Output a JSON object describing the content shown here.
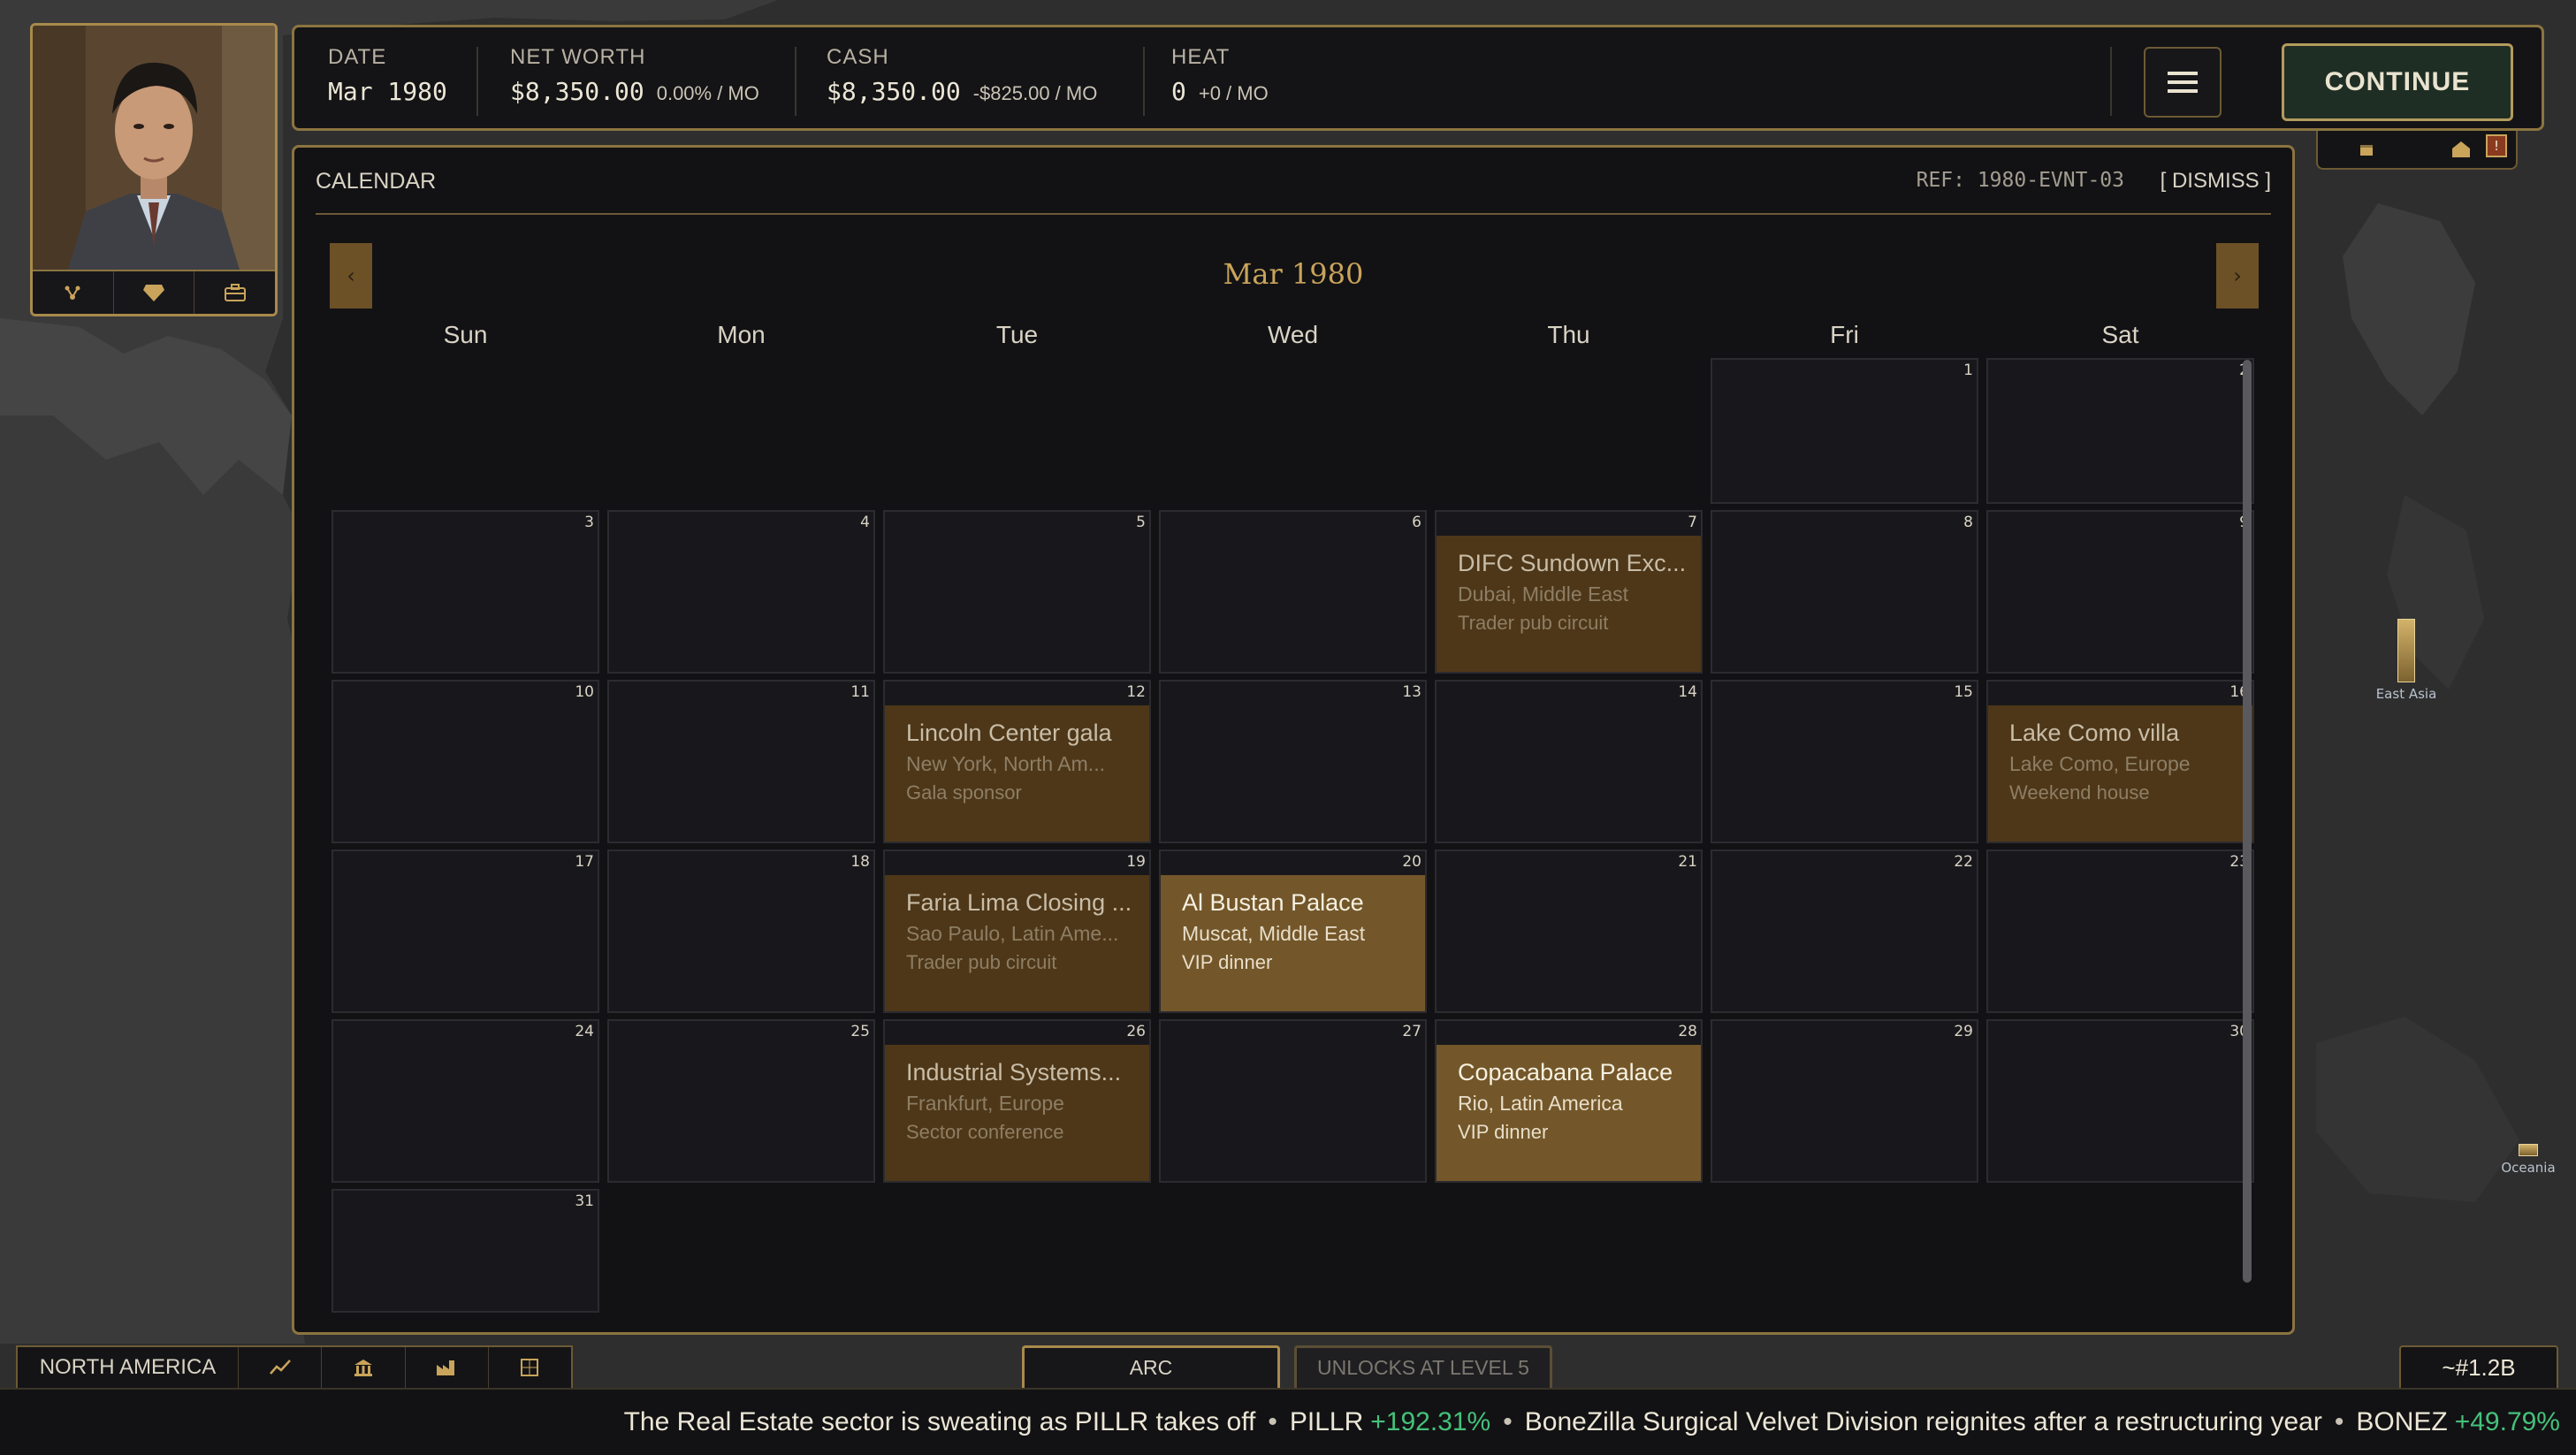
{
  "colors": {
    "accent_gold": "#c9a45a",
    "frame_gold": "#8b7440",
    "continue_bg": "#1f2e24",
    "gain_green": "#45c17a",
    "event_dim": "#4e3718",
    "event_lit": "#73572a"
  },
  "status": {
    "date": {
      "label": "DATE",
      "value": "Mar 1980"
    },
    "net_worth": {
      "label": "NET WORTH",
      "value": "$8,350.00",
      "delta": "0.00% / MO"
    },
    "cash": {
      "label": "CASH",
      "value": "$8,350.00",
      "delta": "-$825.00 / MO"
    },
    "heat": {
      "label": "HEAT",
      "value": "0",
      "delta": "+0 / MO"
    },
    "menu_icon": "hamburger-icon",
    "continue_label": "CONTINUE"
  },
  "mini_panel": {
    "icons": [
      "calendar-icon",
      "house-icon"
    ],
    "alert_badge": "!"
  },
  "avatar_tools": [
    "network-icon",
    "diamond-icon",
    "briefcase-icon"
  ],
  "calendar": {
    "title": "CALENDAR",
    "ref": "REF: 1980-EVNT-03",
    "dismiss": "[ DISMISS ]",
    "month": "Mar 1980",
    "prev_glyph": "‹",
    "next_glyph": "›",
    "weekdays": [
      "Sun",
      "Mon",
      "Tue",
      "Wed",
      "Thu",
      "Fri",
      "Sat"
    ],
    "first_weekday": 5,
    "days_in_month": 31,
    "events": [
      {
        "day": 7,
        "title": "DIFC Sundown Exc...",
        "location": "Dubai, Middle East",
        "type": "Trader pub circuit",
        "style": "dim"
      },
      {
        "day": 12,
        "title": "Lincoln Center gala",
        "location": "New York, North Am...",
        "type": "Gala sponsor",
        "style": "dim"
      },
      {
        "day": 16,
        "title": "Lake Como villa",
        "location": "Lake Como, Europe",
        "type": "Weekend house",
        "style": "dim"
      },
      {
        "day": 19,
        "title": "Faria Lima Closing ...",
        "location": "Sao Paulo, Latin Ame...",
        "type": "Trader pub circuit",
        "style": "dim"
      },
      {
        "day": 20,
        "title": "Al Bustan Palace",
        "location": "Muscat, Middle East",
        "type": "VIP dinner",
        "style": "lit"
      },
      {
        "day": 26,
        "title": "Industrial Systems...",
        "location": "Frankfurt, Europe",
        "type": "Sector conference",
        "style": "dim"
      },
      {
        "day": 28,
        "title": "Copacabana Palace",
        "location": "Rio, Latin America",
        "type": "VIP dinner",
        "style": "lit"
      }
    ]
  },
  "map": {
    "regions": [
      {
        "name": "East Asia",
        "level": 0.45
      },
      {
        "name": "Oceania",
        "level": 0.12
      }
    ]
  },
  "bottom": {
    "region": "NORTH AMERICA",
    "region_tabs": [
      "chart-icon",
      "bank-icon",
      "factory-icon",
      "grid-icon"
    ],
    "tab_arc": "ARC",
    "tab_locked": "UNLOCKS AT LEVEL 5",
    "population": "~#1.2B"
  },
  "ticker": {
    "items": [
      {
        "text": "The Real Estate sector is sweating as PILLR takes off"
      },
      {
        "text": "PILLR",
        "change": "+192.31%"
      },
      {
        "text": "BoneZilla Surgical Velvet Division reignites after a restructuring year"
      },
      {
        "text": "BONEZ",
        "change": "+49.79%"
      }
    ],
    "separator": "•"
  }
}
